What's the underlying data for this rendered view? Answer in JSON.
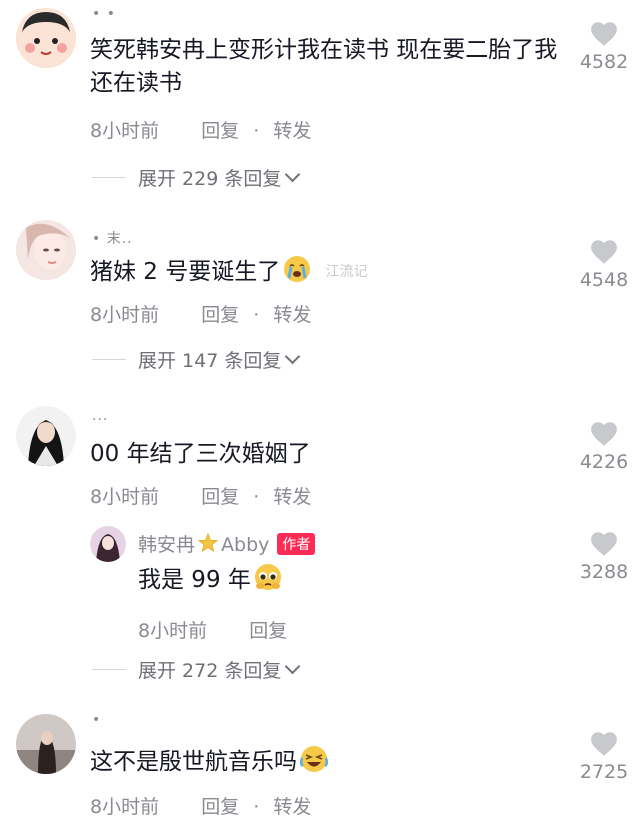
{
  "comments": [
    {
      "username": "• •",
      "text": "笑死韩安冉上变形计我在读书 现在要二胎了我还在读书",
      "time": "8小时前",
      "reply": "回复",
      "dot": "·",
      "forward": "转发",
      "expand": "展开 229 条回复",
      "likes": "4582"
    },
    {
      "username": "• 末..",
      "text": "猪妹 2 号要诞生了",
      "time": "8小时前",
      "reply": "回复",
      "dot": "·",
      "forward": "转发",
      "expand": "展开 147 条回复",
      "likes": "4548"
    },
    {
      "username": "...",
      "text": "00 年结了三次婚姻了",
      "time": "8小时前",
      "reply": "回复",
      "dot": "·",
      "forward": "转发",
      "likes": "4226"
    },
    {
      "username": "•",
      "text": "这不是殷世航音乐吗",
      "time": "8小时前",
      "reply": "回复",
      "dot": "·",
      "forward": "转发",
      "likes": "2725"
    }
  ],
  "author_reply": {
    "name": "韩安冉",
    "name_suffix": "Abby",
    "badge": "作者",
    "text": "我是 99 年",
    "time": "8小时前",
    "reply": "回复",
    "likes": "3288",
    "expand": "展开 272 条回复"
  },
  "watermark": "江流记",
  "icons": {
    "like": "heart-icon",
    "expand": "chevron-down-icon",
    "star": "star-icon",
    "emoji_cry": "crying-face-emoji",
    "emoji_pleading": "pleading-face-emoji",
    "emoji_laugh": "laughing-face-emoji"
  },
  "colors": {
    "text": "#161823",
    "secondary": "#8a8b91",
    "badge": "#fe2c55",
    "heart": "#c8c9cc"
  }
}
